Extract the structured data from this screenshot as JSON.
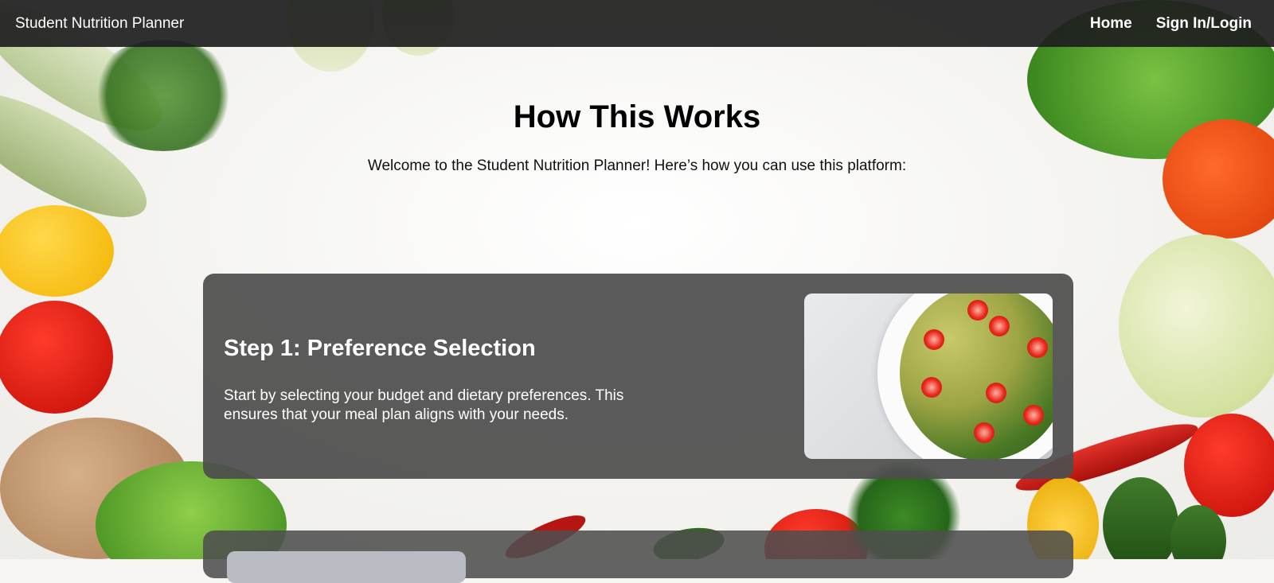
{
  "navbar": {
    "brand": "Student Nutrition Planner",
    "links": [
      {
        "label": "Home"
      },
      {
        "label": "Sign In/Login"
      }
    ]
  },
  "main": {
    "title": "How This Works",
    "intro": "Welcome to the Student Nutrition Planner! Here’s how you can use this platform:"
  },
  "steps": [
    {
      "title": "Step 1: Preference Selection",
      "description": "Start by selecting your budget and dietary preferences. This ensures that your meal plan aligns with your needs."
    }
  ],
  "colors": {
    "navbar_bg": "#1e1e1e",
    "card_bg": "#4e4e4e",
    "text_light": "#ffffff",
    "text_dark": "#000000"
  }
}
